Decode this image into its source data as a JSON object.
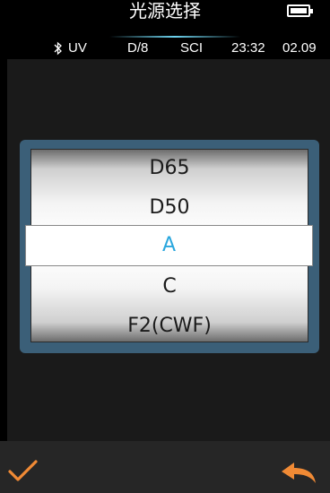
{
  "header": {
    "title": "光源选择",
    "battery_icon": "battery-full-icon"
  },
  "status": {
    "bluetooth_icon": "bluetooth-icon",
    "uv": "UV",
    "geometry": "D/8",
    "mode": "SCI",
    "time": "23:32",
    "date": "02.09"
  },
  "illuminant_list": {
    "items": [
      "D65",
      "D50",
      "A",
      "C",
      "F2(CWF)"
    ],
    "selected_index": 2,
    "selected_color": "#2aa7de"
  },
  "footer": {
    "confirm_icon": "checkmark-icon",
    "back_icon": "back-arrow-icon",
    "accent_color": "#f08a35"
  }
}
